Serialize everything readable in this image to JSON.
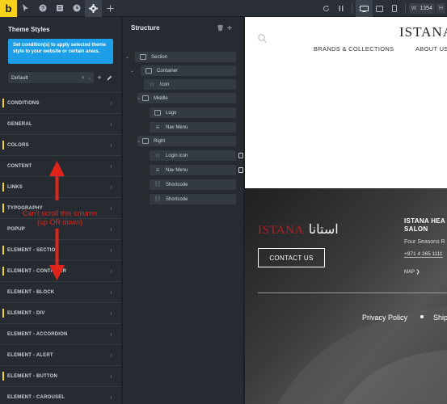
{
  "toolbar": {
    "logo": "b",
    "left_icons": [
      "pointer-icon",
      "help-icon",
      "layers-icon",
      "history-icon",
      "gear-icon",
      "plus-icon"
    ],
    "width_label": "W",
    "width_value": "1354",
    "height_label": "H"
  },
  "theme_styles": {
    "title": "Theme Styles",
    "hint": "Set condition(s) to apply selected theme style to your website or certain areas.",
    "selected_style": "Default",
    "groups": [
      {
        "label": "CONDITIONS",
        "marked": true
      },
      {
        "label": "GENERAL",
        "marked": false
      },
      {
        "label": "COLORS",
        "marked": true
      },
      {
        "label": "CONTENT",
        "marked": false
      },
      {
        "label": "LINKS",
        "marked": true
      },
      {
        "label": "TYPOGRAPHY",
        "marked": true
      },
      {
        "label": "POPUP",
        "marked": false
      },
      {
        "label": "ELEMENT - SECTION",
        "marked": true
      },
      {
        "label": "ELEMENT - CONTAINER",
        "marked": true
      },
      {
        "label": "ELEMENT - BLOCK",
        "marked": false
      },
      {
        "label": "ELEMENT - DIV",
        "marked": true
      },
      {
        "label": "ELEMENT - ACCORDION",
        "marked": false
      },
      {
        "label": "ELEMENT - ALERT",
        "marked": false
      },
      {
        "label": "ELEMENT - BUTTON",
        "marked": true
      },
      {
        "label": "ELEMENT - CAROUSEL",
        "marked": false
      }
    ]
  },
  "structure": {
    "title": "Structure",
    "nodes": [
      {
        "label": "Section",
        "icon": "section-icon",
        "caret": true
      },
      {
        "label": "Container",
        "icon": "container-icon",
        "caret": true
      },
      {
        "label": "Icon",
        "icon": "star-icon",
        "caret": false
      },
      {
        "label": "Middle",
        "icon": "div-icon",
        "caret": true
      },
      {
        "label": "Logo",
        "icon": "image-icon",
        "caret": false
      },
      {
        "label": "Nav Menu",
        "icon": "menu-icon",
        "caret": false
      },
      {
        "label": "Right",
        "icon": "div-icon",
        "caret": true
      },
      {
        "label": "Login icon",
        "icon": "star-icon",
        "caret": false
      },
      {
        "label": "Nav Menu",
        "icon": "menu-icon",
        "caret": false
      },
      {
        "label": "Shortcode",
        "icon": "shortcode-icon",
        "caret": false
      },
      {
        "label": "Shortcode",
        "icon": "shortcode-icon",
        "caret": false
      }
    ]
  },
  "preview": {
    "brand": "ISTANA",
    "nav": [
      "BRANDS & COLLECTIONS",
      "ABOUT US"
    ],
    "footer": {
      "logo_latin": "ISTANA",
      "logo_arabic": "استانا",
      "contact_button": "CONTACT US",
      "heading_line1": "ISTANA HEA",
      "heading_line2": "SALON",
      "address": "Four Seasons R",
      "phone": "+971 4 265 1111",
      "map": "MAP ❯",
      "link1": "Privacy Policy",
      "link2": "Ship"
    }
  },
  "annotation": {
    "text": "Can't scroll this column (up OR down)",
    "color": "#e0241b"
  },
  "colors": {
    "accent": "#f6d21b",
    "hint_blue": "#1c9ee8",
    "panel": "#262b32",
    "brand_red": "#b31f24"
  }
}
